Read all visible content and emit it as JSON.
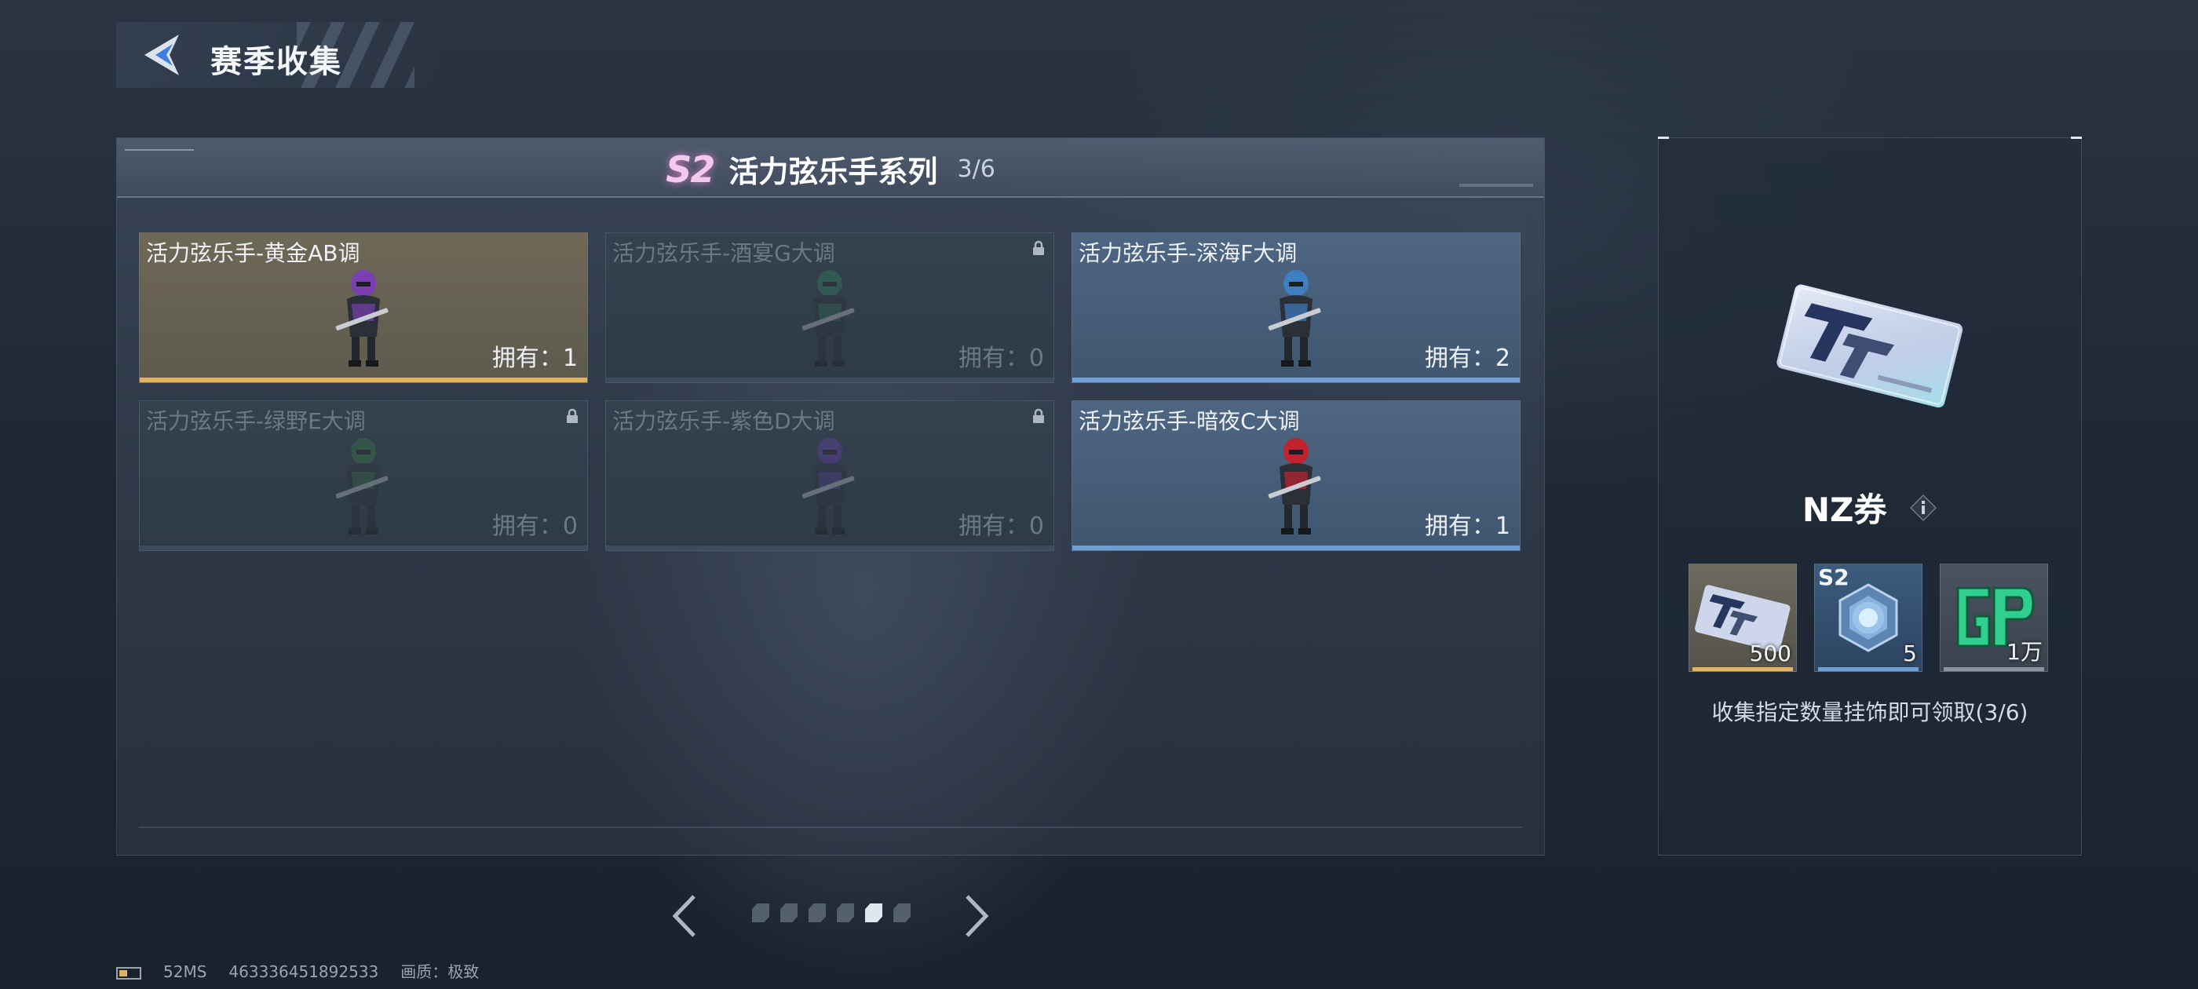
{
  "header": {
    "title": "赛季收集"
  },
  "series": {
    "badge": "S2",
    "name": "活力弦乐手系列",
    "progress": "3/6"
  },
  "cards": [
    {
      "name": "活力弦乐手-黄金AB调",
      "owned": "拥有：1",
      "state": "owned",
      "color": "#e2b261",
      "accent": "#7a3fb0"
    },
    {
      "name": "活力弦乐手-酒宴G大调",
      "owned": "拥有：0",
      "state": "locked",
      "color": "#3d4b5c",
      "accent": "#2b8a5c"
    },
    {
      "name": "活力弦乐手-深海F大调",
      "owned": "拥有：2",
      "state": "owned",
      "color": "#6f9ed4",
      "accent": "#3f7fc0"
    },
    {
      "name": "活力弦乐手-绿野E大调",
      "owned": "拥有：0",
      "state": "locked",
      "color": "#3d4b5c",
      "accent": "#3a8040"
    },
    {
      "name": "活力弦乐手-紫色D大调",
      "owned": "拥有：0",
      "state": "locked",
      "color": "#3d4b5c",
      "accent": "#6a3fb5"
    },
    {
      "name": "活力弦乐手-暗夜C大调",
      "owned": "拥有：1",
      "state": "owned",
      "color": "#6f9ed4",
      "accent": "#c0222e"
    }
  ],
  "pagination": {
    "total": 6,
    "active_index": 4
  },
  "reward": {
    "name": "NZ券",
    "items": [
      {
        "icon": "nz-ticket-icon",
        "qty": "500",
        "bar_color": "#e2b261"
      },
      {
        "icon": "s2-crystal-icon",
        "tag": "S2",
        "qty": "5",
        "bar_color": "#6f9ed4"
      },
      {
        "icon": "gp-icon",
        "qty": "1万",
        "bar_color": "#8a939e"
      }
    ],
    "caption": "收集指定数量挂饰即可领取(3/6)"
  },
  "footer": {
    "ping": "52MS",
    "uid": "463336451892533",
    "quality": "画质：极致"
  },
  "colors": {
    "gold": "#e2b261",
    "blue": "#6f9ed4",
    "season_badge": "#f5c9ee",
    "gp_green": "#2fcf8f"
  }
}
